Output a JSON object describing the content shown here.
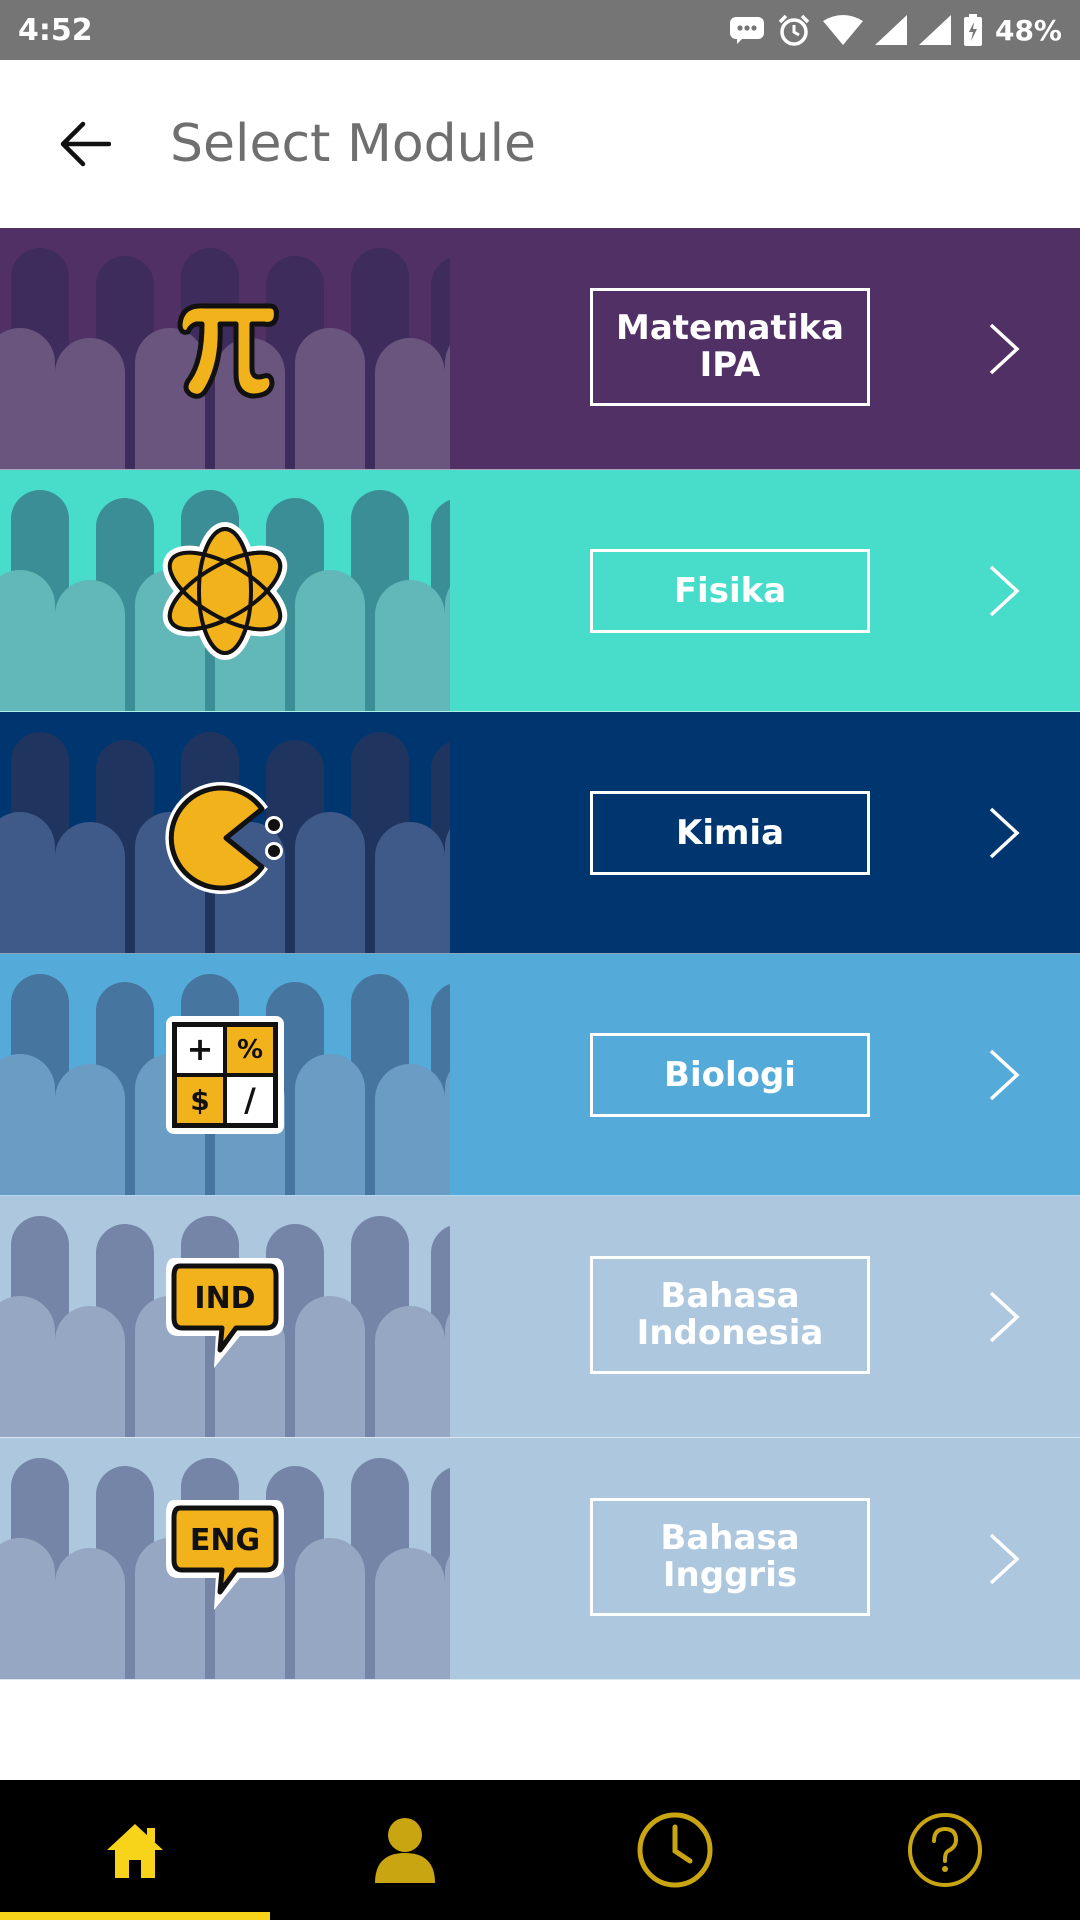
{
  "status_bar": {
    "time": "4:52",
    "battery": "48%"
  },
  "header": {
    "title": "Select Module"
  },
  "modules": [
    {
      "line1": "Matematika",
      "line2": "IPA",
      "icon": "pi-icon",
      "bg": "#513066",
      "art_bg": "#6a557f",
      "art_fg": "#3d2c5c"
    },
    {
      "line1": "Fisika",
      "line2": "",
      "icon": "atom-icon",
      "bg": "#48dccb",
      "art_bg": "#62b7b8",
      "art_fg": "#3b8e95"
    },
    {
      "line1": "Kimia",
      "line2": "",
      "icon": "pacman-icon",
      "bg": "#003670",
      "art_bg": "#3f5a88",
      "art_fg": "#1f3560"
    },
    {
      "line1": "Biologi",
      "line2": "",
      "icon": "calculator-icon",
      "bg": "#54aad9",
      "art_bg": "#6b9cc3",
      "art_fg": "#46759f"
    },
    {
      "line1": "Bahasa",
      "line2": "Indonesia",
      "icon": "ind-speech-bubble-icon",
      "bg": "#adc7df",
      "art_bg": "#96a7c3",
      "art_fg": "#7585a8"
    },
    {
      "line1": "Bahasa",
      "line2": "Inggris",
      "icon": "eng-speech-bubble-icon",
      "bg": "#adc7df",
      "art_bg": "#96a7c3",
      "art_fg": "#7585a8"
    }
  ],
  "icon_text": {
    "ind": "IND",
    "eng": "ENG",
    "plus": "+",
    "percent": "%",
    "dollar": "$",
    "slash": "/"
  },
  "bottom_nav": {
    "items": [
      "home-icon",
      "profile-icon",
      "history-clock-icon",
      "help-icon"
    ],
    "active": "home-icon",
    "accent": "#f7d31a",
    "inactive": "#c9a512"
  },
  "colors": {
    "icon_yellow": "#f2b21b"
  }
}
